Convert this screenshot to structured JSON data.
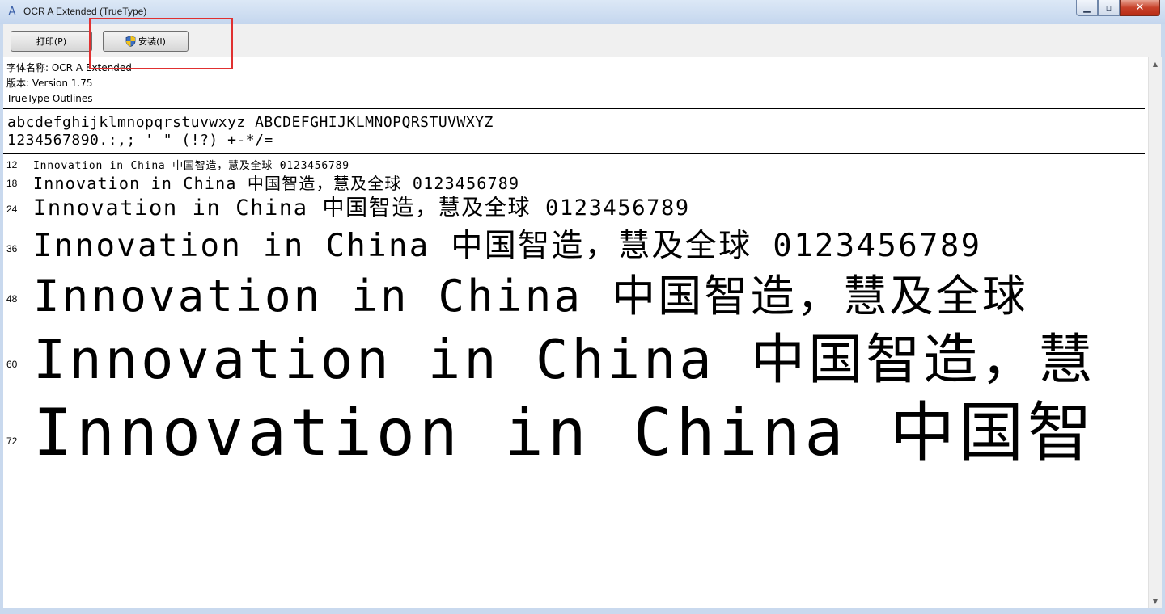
{
  "window": {
    "title": "OCR A Extended (TrueType)",
    "minimize_glyph": "▁",
    "maximize_glyph": "▫",
    "close_glyph": "✕"
  },
  "toolbar": {
    "print_label": "打印(P)",
    "install_label": "安装(I)"
  },
  "font_info": {
    "name_line": "字体名称: OCR A Extended",
    "version_line": "版本: Version 1.75",
    "type_line": "TrueType Outlines"
  },
  "charset": {
    "line1": "abcdefghijklmnopqrstuvwxyz ABCDEFGHIJKLMNOPQRSTUVWXYZ",
    "line2": "1234567890.:,; ' \" (!?) +-*/="
  },
  "samples": [
    {
      "size": "12",
      "text": "Innovation in China 中国智造，慧及全球 0123456789"
    },
    {
      "size": "18",
      "text": "Innovation in China 中国智造，慧及全球 0123456789"
    },
    {
      "size": "24",
      "text": "Innovation in China 中国智造，慧及全球 0123456789"
    },
    {
      "size": "36",
      "text": "Innovation in China 中国智造，慧及全球 0123456789"
    },
    {
      "size": "48",
      "text": "Innovation in China 中国智造，慧及全球"
    },
    {
      "size": "60",
      "text": "Innovation in China 中国智造，慧"
    },
    {
      "size": "72",
      "text": "Innovation in China 中国智"
    }
  ],
  "scrollbar": {
    "up_glyph": "▲",
    "down_glyph": "▼"
  },
  "colors": {
    "highlight": "#e03030",
    "close_button": "#c7412a"
  }
}
